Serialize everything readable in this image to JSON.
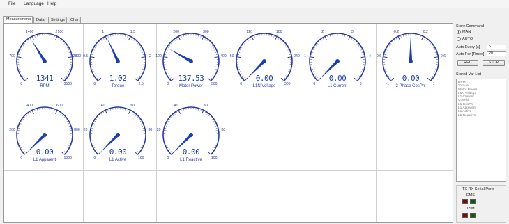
{
  "menu": [
    "File",
    "Language",
    "Help"
  ],
  "tabs": [
    "Measurements",
    "Data",
    "Settings",
    "Chart"
  ],
  "gauges": [
    {
      "label": "RPM",
      "value": "1341",
      "ticks": [
        "0",
        "700",
        "1400",
        "2100",
        "2800",
        "3500"
      ],
      "min": 0,
      "max": 3500,
      "reading": 1341
    },
    {
      "label": "Torque",
      "value": "1.02",
      "ticks": [
        "0",
        "0.5",
        "1",
        "1.5",
        "2",
        "2.5"
      ],
      "min": 0,
      "max": 2.5,
      "reading": 1.02
    },
    {
      "label": "Motor Power",
      "value": "137.53",
      "ticks": [
        "0",
        "100",
        "200",
        "300",
        "400",
        "500"
      ],
      "min": 0,
      "max": 500,
      "reading": 137.53
    },
    {
      "label": "L1N Voltage",
      "value": "0.00",
      "ticks": [
        "0",
        "60",
        "120",
        "180",
        "240",
        "300"
      ],
      "min": 0,
      "max": 300,
      "reading": 0
    },
    {
      "label": "L1 Current",
      "value": "0.00",
      "ticks": [
        "0",
        "1",
        "2",
        "3",
        "4",
        "5"
      ],
      "min": 0,
      "max": 5,
      "reading": 0
    },
    {
      "label": "3 Phase CosPhi",
      "value": "0.00",
      "ticks": [
        "-1",
        "-0.6",
        "-0.2",
        "0.2",
        "0.6",
        "1"
      ],
      "min": -1,
      "max": 1,
      "reading": 0
    },
    {
      "label": "L1 Apparent",
      "value": "0.00",
      "ticks": [
        "0",
        "200",
        "400",
        "600",
        "800",
        "1000"
      ],
      "min": 0,
      "max": 1000,
      "reading": 0
    },
    {
      "label": "L1 Active",
      "value": "0.00",
      "ticks": [
        "0",
        "20",
        "40",
        "60",
        "80",
        "100"
      ],
      "min": 0,
      "max": 100,
      "reading": 0
    },
    {
      "label": "L1 Reactive",
      "value": "0.00",
      "ticks": [
        "0",
        "20",
        "40",
        "60",
        "80",
        "100"
      ],
      "min": 0,
      "max": 100,
      "reading": 0
    }
  ],
  "side": {
    "store_command": "Store Command",
    "man": "MAN",
    "auto": "AUTO",
    "mode_selected": "MAN",
    "auto_every_label": "Auto Every [s]",
    "auto_every_value": "5",
    "auto_for_label": "Auto For [Times]",
    "auto_for_value": "20",
    "rec_button": "REC",
    "stop_button": "STOP",
    "stored_var_list": "Stored Var List",
    "vars": [
      "RPM",
      "Torque",
      "Motor Power",
      "L1N Voltage",
      "L1 Current",
      "CosPhi",
      "L1 CosPhi",
      "L1 Apparent",
      "L1 Active",
      "L1 Reactive"
    ],
    "ports_title": "TX RX Serial Ports",
    "port1": "EMS",
    "port2": "TSM"
  },
  "colors": {
    "needle": "#1a3fb0",
    "arc": "#2a3aa0",
    "led_red": "#8b0000",
    "led_green": "#006400"
  }
}
